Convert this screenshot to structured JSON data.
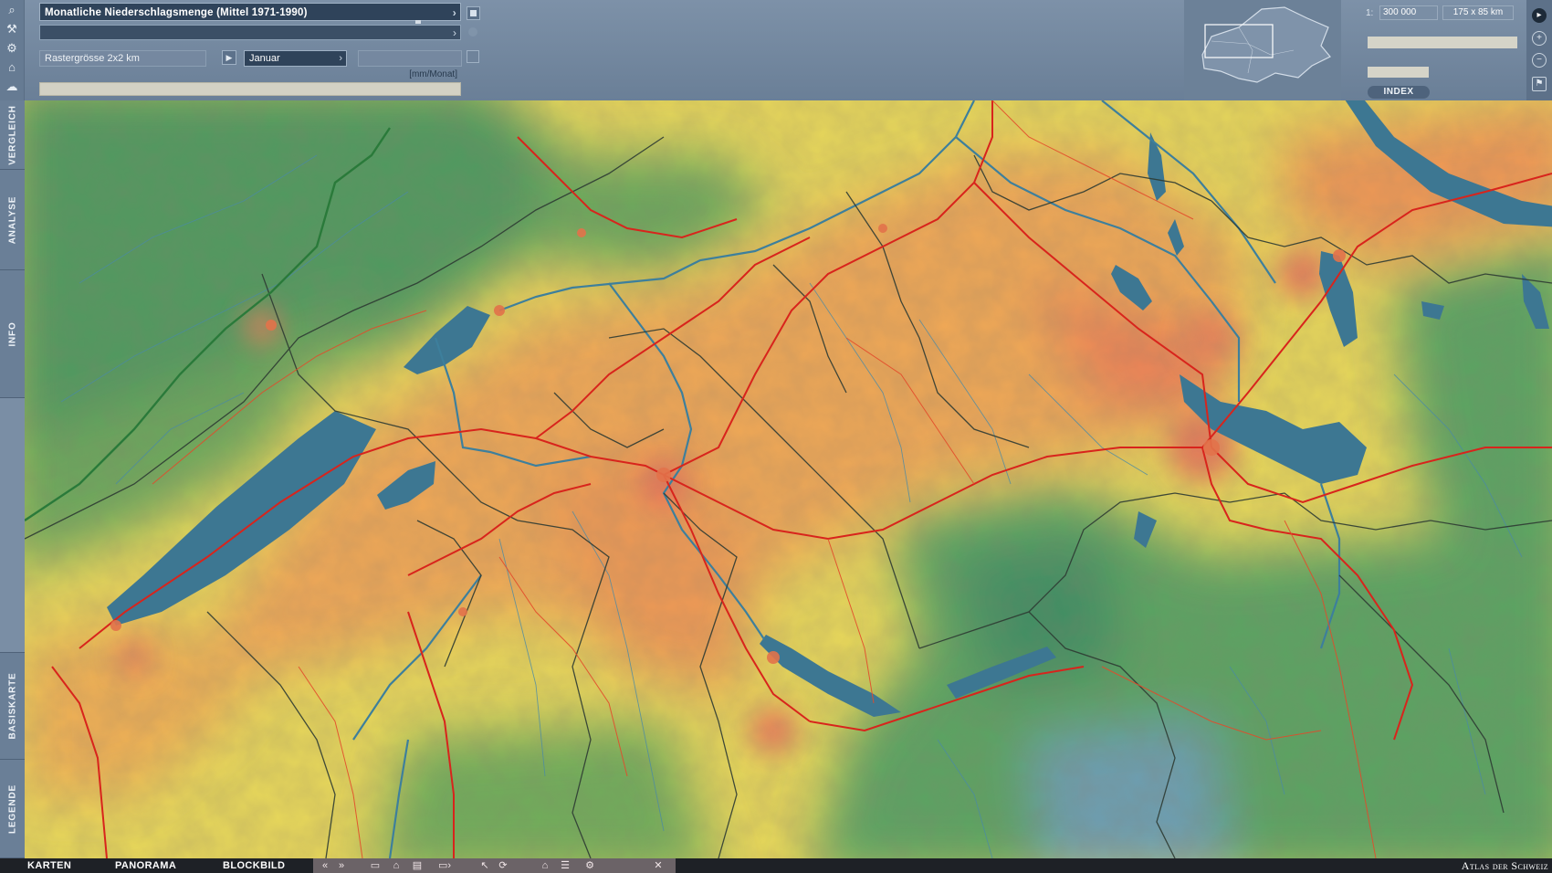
{
  "header": {
    "map_title": "Monatliche Niederschlagsmenge (Mittel 1971-1990)",
    "sub_field": "",
    "raster_label": "Rastergrösse 2x2 km",
    "month": "Januar",
    "unit": "[mm/Monat]"
  },
  "scale": {
    "prefix": "1:",
    "value": "300 000",
    "extent": "175 x 85 km",
    "index_label": "INDEX"
  },
  "side_tabs": [
    "VERGLEICH",
    "ANALYSE",
    "INFO",
    "BASISKARTE",
    "LEGENDE"
  ],
  "bottom_tabs": [
    "KARTEN",
    "PANORAMA",
    "BLOCKBILD"
  ],
  "bottom_tools": [
    "«",
    "»",
    "print-icon",
    "lock-icon",
    "printer-icon",
    "export-icon",
    "pointer-icon",
    "rotate-icon",
    "home-icon",
    "list-icon",
    "settings-icon",
    "close-icon"
  ],
  "brand": "Atlas der Schweiz",
  "colors": {
    "precip_low": "#e07a5a",
    "precip_mid": "#f0c84a",
    "precip_high": "#4f9a5a",
    "water": "#3d7792",
    "road": "#d8241c",
    "border": "#2e3b33"
  }
}
